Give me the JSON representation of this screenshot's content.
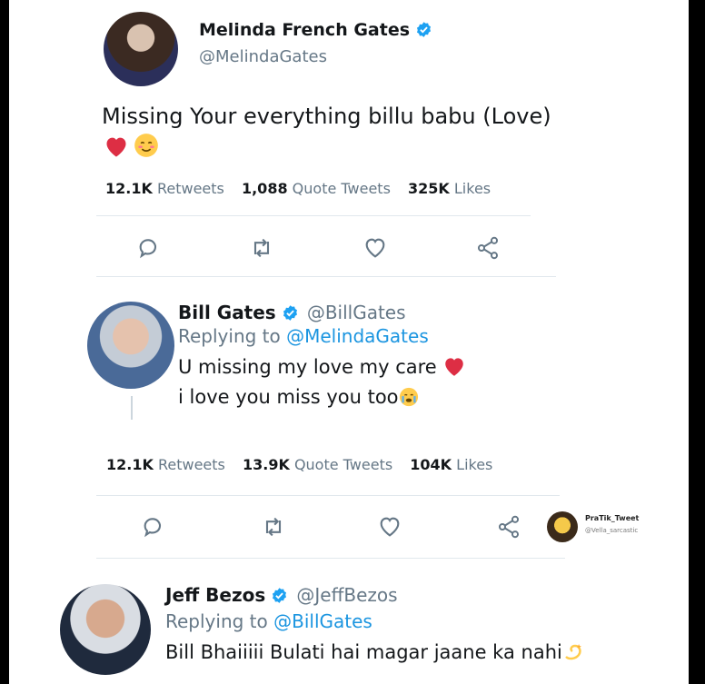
{
  "tweet1": {
    "name": "Melinda French Gates",
    "handle": "@MelindaGates",
    "text": "Missing Your everything billu babu (Love)",
    "stats": {
      "retweets_count": "12.1K",
      "retweets_label": "Retweets",
      "quotes_count": "1,088",
      "quotes_label": "Quote Tweets",
      "likes_count": "325K",
      "likes_label": "Likes"
    }
  },
  "tweet2": {
    "name": "Bill Gates",
    "handle": "@BillGates",
    "replying_prefix": "Replying to",
    "replying_to": "@MelindaGates",
    "line1": "U missing my love my care",
    "line2": "i love you miss you too",
    "stats": {
      "retweets_count": "12.1K",
      "retweets_label": "Retweets",
      "quotes_count": "13.9K",
      "quotes_label": "Quote Tweets",
      "likes_count": "104K",
      "likes_label": "Likes"
    }
  },
  "tweet3": {
    "name": "Jeff Bezos",
    "handle": "@JeffBezos",
    "replying_prefix": "Replying to",
    "replying_to": "@BillGates",
    "text": "Bill Bhaiiiii Bulati hai magar jaane ka nahi"
  },
  "watermark": {
    "title": "PraTik_Tweet",
    "subtitle": "@Vella_sarcastic"
  },
  "icons": {
    "verified": "verified-badge-icon",
    "reply": "reply-icon",
    "retweet": "retweet-icon",
    "like": "heart-icon",
    "share": "share-icon",
    "red_heart": "red-heart-emoji",
    "smiling_face": "smiling-face-emoji",
    "crying_face": "crying-face-emoji",
    "dizzy": "dizzy-emoji"
  },
  "colors": {
    "verified": "#1da1f2",
    "text": "#14171a",
    "muted": "#657786",
    "link": "#1b95e0",
    "heart": "#e0245e"
  }
}
